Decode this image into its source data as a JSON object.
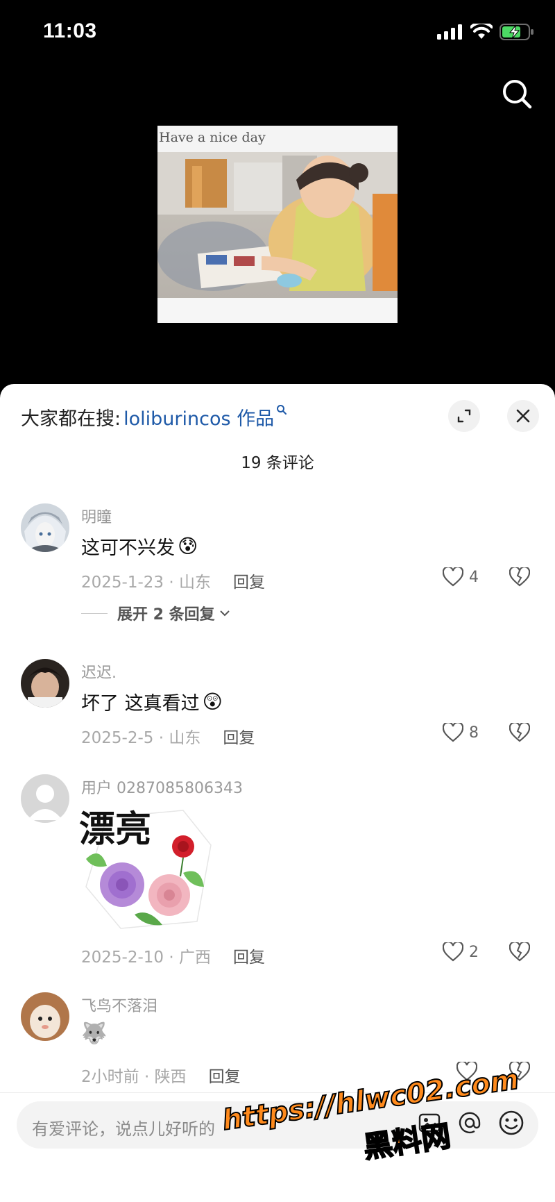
{
  "status": {
    "time": "11:03"
  },
  "video": {
    "caption": "Have a nice day"
  },
  "sheet": {
    "hot_search_label": "大家都在搜:",
    "hot_search_keyword": "loliburincos 作品",
    "comment_count": "19 条评论"
  },
  "comments": [
    {
      "user": "明瞳",
      "text": "这可不兴发",
      "emoji": "😰",
      "date_loc": "2025-1-23 · 山东",
      "reply_label": "回复",
      "likes": "4",
      "expand_label": "展开 2 条回复"
    },
    {
      "user": "迟迟.",
      "text": "坏了 这真看过",
      "emoji": "😲",
      "date_loc": "2025-2-5 · 山东",
      "reply_label": "回复",
      "likes": "8"
    },
    {
      "user": "用户 0287085806343",
      "sticker_text": "漂亮",
      "date_loc": "2025-2-10 · 广西",
      "reply_label": "回复",
      "likes": "2"
    },
    {
      "user": "飞鸟不落泪",
      "emoji": "🐺",
      "date_loc": "2小时前 · 陕西",
      "reply_label": "回复",
      "likes": ""
    }
  ],
  "input": {
    "placeholder": "有爱评论，说点儿好听的"
  },
  "watermark": {
    "url": "https://hlwc02.com",
    "name": "黑料网"
  },
  "colors": {
    "link": "#1f5aa8",
    "watermark": "#ff8a1c"
  }
}
